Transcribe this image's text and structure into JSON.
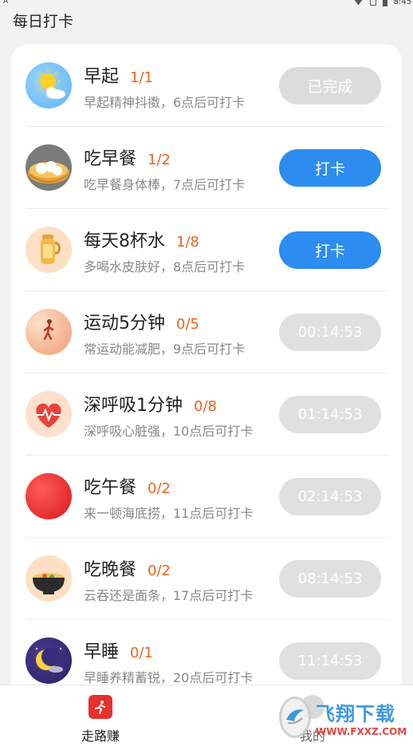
{
  "status": {
    "left": "A",
    "time": "8:45"
  },
  "header": {
    "title": "每日打卡"
  },
  "tasks": [
    {
      "title": "早起",
      "count": "1/1",
      "desc": "早起精神抖擞，6点后可打卡",
      "button": "已完成",
      "state": "done",
      "icon": "sun-cloud-icon"
    },
    {
      "title": "吃早餐",
      "count": "1/2",
      "desc": "吃早餐身体棒，7点后可打卡",
      "button": "打卡",
      "state": "active",
      "icon": "steamed-buns-icon"
    },
    {
      "title": "每天8杯水",
      "count": "1/8",
      "desc": "多喝水皮肤好，8点后可打卡",
      "button": "打卡",
      "state": "active",
      "icon": "thermos-icon"
    },
    {
      "title": "运动5分钟",
      "count": "0/5",
      "desc": "常运动能减肥，9点后可打卡",
      "button": "00:14:53",
      "state": "wait",
      "icon": "runner-icon"
    },
    {
      "title": "深呼吸1分钟",
      "count": "0/8",
      "desc": "深呼吸心脏强，10点后可打卡",
      "button": "01:14:53",
      "state": "wait",
      "icon": "heart-icon"
    },
    {
      "title": "吃午餐",
      "count": "0/2",
      "desc": "来一顿海底捞，11点后可打卡",
      "button": "02:14:53",
      "state": "wait",
      "icon": "red-circle-icon"
    },
    {
      "title": "吃晚餐",
      "count": "0/2",
      "desc": "云吞还是面条，17点后可打卡",
      "button": "08:14:53",
      "state": "wait",
      "icon": "noodle-bowl-icon"
    },
    {
      "title": "早睡",
      "count": "0/1",
      "desc": "早睡养精蓄锐，20点后可打卡",
      "button": "11:14:53",
      "state": "wait",
      "icon": "moon-icon"
    }
  ],
  "nav": {
    "walk": "走路赚",
    "mine": "我的"
  },
  "watermark": {
    "text": "飞翔下载",
    "url": "WWW.FXXZ.COM"
  },
  "colors": {
    "accent": "#2d8cf0",
    "count": "#e9651e",
    "done": "#dcdcdc",
    "wait": "#e0e0e0"
  }
}
